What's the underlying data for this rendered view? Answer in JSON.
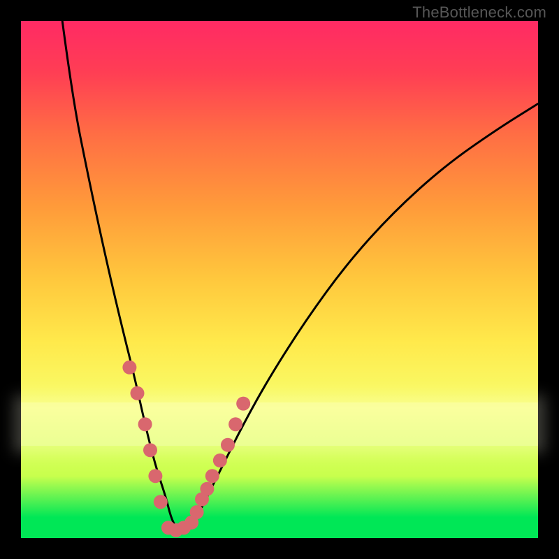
{
  "watermark": "TheBottleneck.com",
  "chart_data": {
    "type": "line",
    "title": "",
    "xlabel": "",
    "ylabel": "",
    "xlim": [
      0,
      100
    ],
    "ylim": [
      0,
      100
    ],
    "series": [
      {
        "name": "bottleneck-curve",
        "x": [
          8,
          10,
          13,
          16,
          19,
          22,
          24,
          26,
          28,
          29,
          30,
          31,
          32,
          34,
          36,
          39,
          43,
          48,
          55,
          63,
          72,
          82,
          92,
          100
        ],
        "y": [
          100,
          85,
          70,
          56,
          43,
          31,
          22,
          14,
          8,
          4,
          2,
          1,
          2,
          4,
          8,
          14,
          22,
          31,
          42,
          53,
          63,
          72,
          79,
          84
        ]
      },
      {
        "name": "highlight-dots-left",
        "x": [
          21.0,
          22.5,
          24.0,
          25.0,
          26.0,
          27.0
        ],
        "y": [
          33.0,
          28.0,
          22.0,
          17.0,
          12.0,
          7.0
        ]
      },
      {
        "name": "highlight-dots-right",
        "x": [
          33.0,
          34.0,
          35.0,
          36.0,
          37.0,
          38.5,
          40.0,
          41.5,
          43.0
        ],
        "y": [
          3.0,
          5.0,
          7.5,
          9.5,
          12.0,
          15.0,
          18.0,
          22.0,
          26.0
        ]
      },
      {
        "name": "highlight-dots-bottom",
        "x": [
          28.5,
          30.0,
          31.5
        ],
        "y": [
          2.0,
          1.5,
          2.0
        ]
      }
    ],
    "colors": {
      "curve": "#000000",
      "dots": "#d9676e",
      "background_top": "#ff2a64",
      "background_bottom": "#00e756",
      "glow_band": "#ffffe6"
    }
  }
}
